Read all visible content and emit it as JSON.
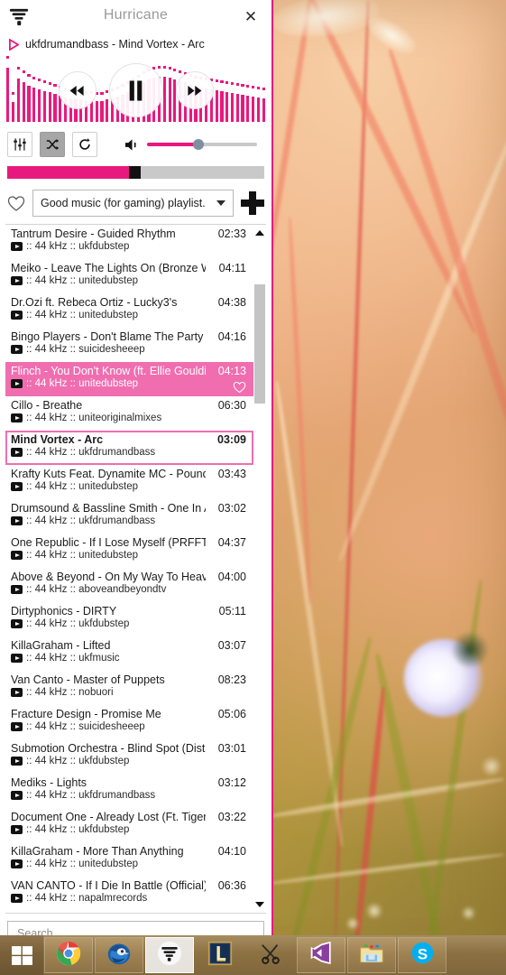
{
  "window": {
    "title": "Hurricane",
    "close_label": "✕",
    "logo_icon": "tornado-icon"
  },
  "now_playing": {
    "text": "ukfdrumandbass - Mind Vortex - Arc",
    "play_icon": "play-triangle-icon"
  },
  "transport": {
    "prev_label": "rewind-icon",
    "play_pause_label": "pause-icon",
    "next_label": "fast-forward-icon"
  },
  "controls": {
    "equalizer_icon": "equalizer-icon",
    "shuffle_icon": "shuffle-icon",
    "repeat_icon": "repeat-icon",
    "shuffle_active": true,
    "volume_icon": "speaker-icon",
    "volume_percent": 47,
    "seek_percent": 47.5
  },
  "playlist_bar": {
    "favorite_icon": "heart-icon",
    "selected_playlist": "Good music (for gaming) playlist.",
    "add_label": "add-playlist-icon"
  },
  "search": {
    "placeholder": "Search...",
    "value": ""
  },
  "colors": {
    "accent": "#e8197e",
    "selected_row": "#f06eb0",
    "playing_border": "#f06eb0",
    "title_text": "#9a9a9a",
    "volume_knob": "#7e8f9e"
  },
  "scrollbar": {
    "up_icon": "chevron-up-icon",
    "down_icon": "chevron-down-icon"
  },
  "tracks": [
    {
      "name": "Tantrum Desire - Guided Rhythm",
      "duration": "02:33",
      "meta": ":: 44 kHz :: ukfdubstep",
      "state": "normal"
    },
    {
      "name": "Meiko - Leave The Lights On (Bronze Wh...",
      "duration": "04:11",
      "meta": ":: 44 kHz :: unitedubstep",
      "state": "normal"
    },
    {
      "name": "Dr.Ozi ft. Rebeca Ortiz - Lucky3's",
      "duration": "04:38",
      "meta": ":: 44 kHz :: unitedubstep",
      "state": "normal"
    },
    {
      "name": "Bingo Players - Don't Blame The Party (C...",
      "duration": "04:16",
      "meta": ":: 44 kHz :: suicidesheeep",
      "state": "normal"
    },
    {
      "name": "Flinch - You Don't Know (ft. Ellie Goulding)",
      "duration": "04:13",
      "meta": ":: 44 kHz :: unitedubstep",
      "state": "selected"
    },
    {
      "name": "Cillo - Breathe",
      "duration": "06:30",
      "meta": ":: 44 kHz :: uniteoriginalmixes",
      "state": "normal"
    },
    {
      "name": "Mind Vortex - Arc",
      "duration": "03:09",
      "meta": ":: 44 kHz :: ukfdrumandbass",
      "state": "playing"
    },
    {
      "name": "Krafty Kuts Feat. Dynamite MC - Poundin...",
      "duration": "03:43",
      "meta": ":: 44 kHz :: unitedubstep",
      "state": "normal"
    },
    {
      "name": "Drumsound & Bassline Smith - One In A...",
      "duration": "03:02",
      "meta": ":: 44 kHz :: ukfdrumandbass",
      "state": "normal"
    },
    {
      "name": "One Republic - If I Lose Myself (PRFFTT...",
      "duration": "04:37",
      "meta": ":: 44 kHz :: unitedubstep",
      "state": "normal"
    },
    {
      "name": "Above & Beyond - On My Way To Heave...",
      "duration": "04:00",
      "meta": ":: 44 kHz :: aboveandbeyondtv",
      "state": "normal"
    },
    {
      "name": "Dirtyphonics - DIRTY",
      "duration": "05:11",
      "meta": ":: 44 kHz :: ukfdubstep",
      "state": "normal"
    },
    {
      "name": "KillaGraham - Lifted",
      "duration": "03:07",
      "meta": ":: 44 kHz :: ukfmusic",
      "state": "normal"
    },
    {
      "name": "Van Canto - Master of Puppets",
      "duration": "08:23",
      "meta": ":: 44 kHz :: nobuori",
      "state": "normal"
    },
    {
      "name": "Fracture Design - Promise Me",
      "duration": "05:06",
      "meta": ":: 44 kHz :: suicidesheeep",
      "state": "normal"
    },
    {
      "name": "Submotion Orchestra - Blind Spot (Dista...",
      "duration": "03:01",
      "meta": ":: 44 kHz :: ukfdubstep",
      "state": "normal"
    },
    {
      "name": "Mediks - Lights",
      "duration": "03:12",
      "meta": ":: 44 kHz :: ukfdrumandbass",
      "state": "normal"
    },
    {
      "name": "Document One - Already Lost (Ft. Tigerli...",
      "duration": "03:22",
      "meta": ":: 44 kHz :: ukfdubstep",
      "state": "normal"
    },
    {
      "name": "KillaGraham - More Than Anything",
      "duration": "04:10",
      "meta": ":: 44 kHz :: unitedubstep",
      "state": "normal"
    },
    {
      "name": "VAN CANTO - If I Die In Battle (Official)",
      "duration": "06:36",
      "meta": ":: 44 kHz :: napalmrecords",
      "state": "normal"
    }
  ],
  "visualizer": {
    "heights": [
      60,
      22,
      48,
      44,
      40,
      38,
      36,
      34,
      33,
      31,
      29,
      27,
      26,
      26,
      25,
      24,
      24,
      23,
      23,
      25,
      26,
      28,
      30,
      33,
      36,
      40,
      44,
      47,
      49,
      50,
      50,
      49,
      47,
      45,
      43,
      41,
      39,
      38,
      37,
      36,
      35,
      34,
      33,
      32,
      31,
      30,
      29,
      28,
      27,
      26
    ],
    "caps": [
      70,
      30,
      58,
      54,
      50,
      47,
      45,
      43,
      41,
      39,
      37,
      35,
      34,
      33,
      32,
      31,
      31,
      30,
      30,
      32,
      34,
      36,
      39,
      42,
      45,
      49,
      53,
      56,
      58,
      59,
      59,
      58,
      56,
      54,
      52,
      50,
      48,
      47,
      46,
      45,
      44,
      43,
      42,
      41,
      40,
      39,
      38,
      37,
      36,
      35
    ]
  },
  "taskbar": {
    "start_label": "windows-start-icon",
    "items": [
      {
        "icon": "chrome-icon",
        "label": "Google Chrome",
        "active": false
      },
      {
        "icon": "thunderbird-icon",
        "label": "Mozilla Thunderbird",
        "active": false
      },
      {
        "icon": "hurricane-icon",
        "label": "Hurricane",
        "active": true
      },
      {
        "icon": "league-of-legends-icon",
        "label": "League of Legends",
        "active": false
      },
      {
        "icon": "snipping-tool-icon",
        "label": "Snipping Tool",
        "active": false
      },
      {
        "icon": "visual-studio-icon",
        "label": "Visual Studio",
        "active": false
      },
      {
        "icon": "file-explorer-icon",
        "label": "File Explorer",
        "active": false
      },
      {
        "icon": "skype-icon",
        "label": "Skype",
        "active": false
      }
    ]
  }
}
